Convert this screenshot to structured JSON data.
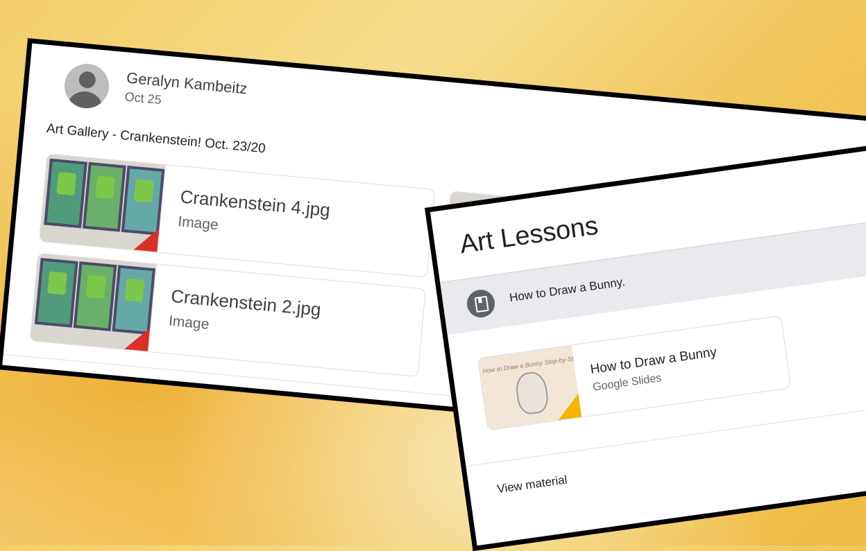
{
  "post": {
    "author": "Geralyn Kambeitz",
    "date": "Oct 25",
    "text": "Art Gallery - Crankenstein! Oct. 23/20",
    "attachments": [
      {
        "title": "Crankenstein 4.jpg",
        "type": "Image"
      },
      {
        "title": "Crankenstein 2.jpg",
        "type": "Image"
      }
    ]
  },
  "topic": {
    "title": "Art Lessons",
    "lesson": "How to Draw a Bunny.",
    "material": {
      "title": "How to Draw a Bunny",
      "type": "Google Slides",
      "thumb_caption": "How to Draw a Bunny Step-by-Step"
    },
    "view_label": "View material"
  },
  "colors": {
    "image_corner": "#d93025",
    "slides_corner": "#f4b400",
    "background": "#f3cf6a"
  }
}
